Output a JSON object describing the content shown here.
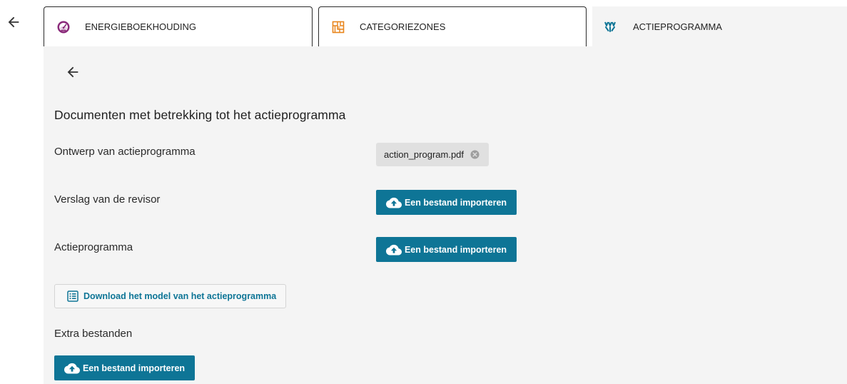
{
  "tabs": [
    {
      "label": "ENERGIEBOEKHOUDING",
      "icon": "gauge-icon",
      "color": "#8a2a7a"
    },
    {
      "label": "CATEGORIEZONES",
      "icon": "zones-map-icon",
      "color": "#e8841a"
    },
    {
      "label": "ACTIEPROGRAMMA",
      "icon": "action-program-icon",
      "color": "#0e7596",
      "active": true
    }
  ],
  "section": {
    "title": "Documenten met betrekking tot het actieprogramma"
  },
  "rows": [
    {
      "label": "Ontwerp van actieprogramma",
      "file": "action_program.pdf"
    },
    {
      "label": "Verslag van de revisor",
      "button": "Een bestand importeren"
    },
    {
      "label": "Actieprogramma",
      "button": "Een bestand importeren"
    }
  ],
  "download": {
    "label": "Download het model van het actieprogramma"
  },
  "extra": {
    "label": "Extra bestanden",
    "button": "Een bestand importeren"
  },
  "colors": {
    "primary": "#0e7596",
    "panel_bg": "#f4f4f4",
    "chip_bg": "#e0e0e0"
  }
}
